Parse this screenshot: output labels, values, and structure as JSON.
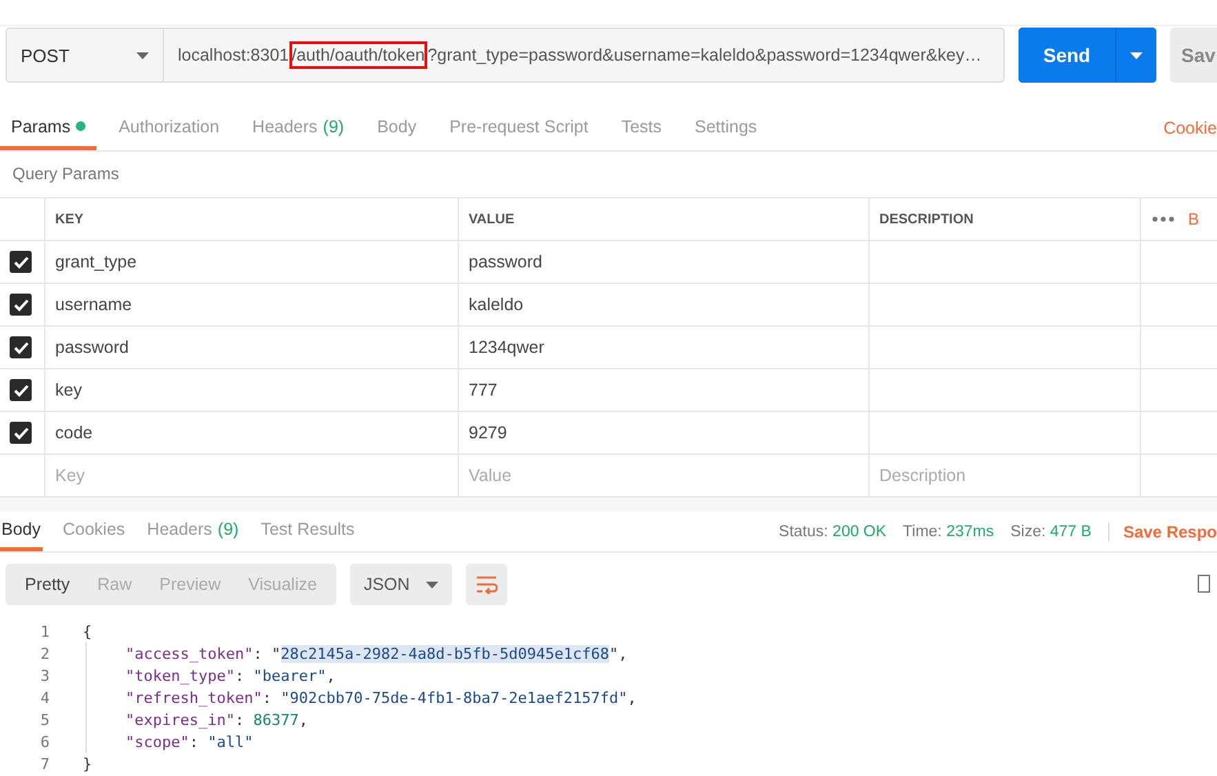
{
  "request": {
    "method": "POST",
    "url": {
      "before": "localhost:8301",
      "highlighted": "/auth/oauth/token",
      "after": "?grant_type=password&username=kaleldo&password=1234qwer&key…"
    },
    "send": "Send",
    "save": "Sav"
  },
  "request_tabs": [
    {
      "label": "Params",
      "dot": true,
      "selected": true
    },
    {
      "label": "Authorization",
      "dot": false,
      "selected": false
    },
    {
      "label": "Headers",
      "count": "(9)",
      "dot": false,
      "selected": false
    },
    {
      "label": "Body",
      "dot": false,
      "selected": false
    },
    {
      "label": "Pre-request Script",
      "dot": false,
      "selected": false
    },
    {
      "label": "Tests",
      "dot": false,
      "selected": false
    },
    {
      "label": "Settings",
      "dot": false,
      "selected": false
    }
  ],
  "cookies_link": "Cookie",
  "query_params": {
    "title": "Query Params",
    "columns": [
      "KEY",
      "VALUE",
      "DESCRIPTION"
    ],
    "bulk_edit": "B",
    "rows": [
      {
        "checked": true,
        "key": "grant_type",
        "value": "password"
      },
      {
        "checked": true,
        "key": "username",
        "value": "kaleldo"
      },
      {
        "checked": true,
        "key": "password",
        "value": "1234qwer"
      },
      {
        "checked": true,
        "key": "key",
        "value": "777"
      },
      {
        "checked": true,
        "key": "code",
        "value": "9279"
      }
    ],
    "new_row": [
      {
        "placeholder": "Key"
      },
      {
        "placeholder": "Value"
      },
      {
        "placeholder": "Description"
      }
    ]
  },
  "response_tabs": [
    {
      "label": "Body",
      "selected": true
    },
    {
      "label": "Cookies",
      "selected": false
    },
    {
      "label": "Headers",
      "count": "(9)",
      "selected": false
    },
    {
      "label": "Test Results",
      "selected": false
    }
  ],
  "status": [
    {
      "label": "Status:",
      "value": "200 OK"
    },
    {
      "label": "Time:",
      "value": "237ms"
    },
    {
      "label": "Size:",
      "value": "477 B"
    }
  ],
  "save_response": "Save Respo",
  "view_modes": [
    {
      "label": "Pretty",
      "selected": true
    },
    {
      "label": "Raw",
      "selected": false
    },
    {
      "label": "Preview",
      "selected": false
    },
    {
      "label": "Visualize",
      "selected": false
    }
  ],
  "format": "JSON",
  "code": [
    {
      "number": "1",
      "kind": "brace",
      "segments": [
        {
          "text": "{",
          "kind": "punct",
          "selected": false
        }
      ]
    },
    {
      "number": "2",
      "kind": "member",
      "segments": [
        {
          "text": "\"access_token\"",
          "kind": "key",
          "selected": false
        },
        {
          "text": ": \"",
          "kind": "punct",
          "selected": false
        },
        {
          "text": "28c2145a-2982-4a8d-b5fb-5d0945e1cf68",
          "kind": "string",
          "selected": true
        },
        {
          "text": "\",",
          "kind": "punct",
          "selected": false
        }
      ]
    },
    {
      "number": "3",
      "kind": "member",
      "segments": [
        {
          "text": "\"token_type\"",
          "kind": "key",
          "selected": false
        },
        {
          "text": ": ",
          "kind": "punct",
          "selected": false
        },
        {
          "text": "\"bearer\"",
          "kind": "string",
          "selected": false
        },
        {
          "text": ",",
          "kind": "punct",
          "selected": false
        }
      ]
    },
    {
      "number": "4",
      "kind": "member",
      "segments": [
        {
          "text": "\"refresh_token\"",
          "kind": "key",
          "selected": false
        },
        {
          "text": ": ",
          "kind": "punct",
          "selected": false
        },
        {
          "text": "\"902cbb70-75de-4fb1-8ba7-2e1aef2157fd\"",
          "kind": "string",
          "selected": false
        },
        {
          "text": ",",
          "kind": "punct",
          "selected": false
        }
      ]
    },
    {
      "number": "5",
      "kind": "member",
      "segments": [
        {
          "text": "\"expires_in\"",
          "kind": "key",
          "selected": false
        },
        {
          "text": ": ",
          "kind": "punct",
          "selected": false
        },
        {
          "text": "86377",
          "kind": "number",
          "selected": false
        },
        {
          "text": ",",
          "kind": "punct",
          "selected": false
        }
      ]
    },
    {
      "number": "6",
      "kind": "member",
      "segments": [
        {
          "text": "\"scope\"",
          "kind": "key",
          "selected": false
        },
        {
          "text": ": ",
          "kind": "punct",
          "selected": false
        },
        {
          "text": "\"all\"",
          "kind": "string",
          "selected": false
        }
      ]
    },
    {
      "number": "7",
      "kind": "brace",
      "segments": [
        {
          "text": "}",
          "kind": "punct",
          "selected": false
        }
      ]
    }
  ]
}
